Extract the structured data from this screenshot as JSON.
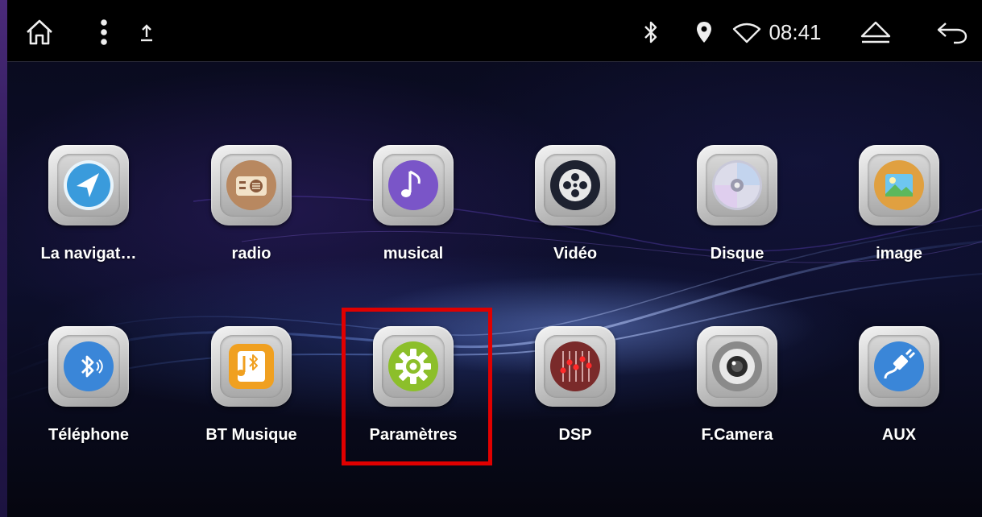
{
  "statusbar": {
    "home_icon": "home-icon",
    "menu_icon": "more-vertical-icon",
    "upload_icon": "upload-arrow-icon",
    "bluetooth_icon": "bluetooth-icon",
    "location_icon": "location-pin-icon",
    "wifi_icon": "wifi-icon",
    "time": "08:41",
    "eject_icon": "eject-icon",
    "back_icon": "back-arrow-icon"
  },
  "apps": [
    {
      "label": "La navigat…",
      "icon": "navigation-icon",
      "color": "#3a9bdc"
    },
    {
      "label": "radio",
      "icon": "radio-icon",
      "color": "#8a5a3c"
    },
    {
      "label": "musical",
      "icon": "music-note-icon",
      "color": "#7a55c8"
    },
    {
      "label": "Vidéo",
      "icon": "film-reel-icon",
      "color": "#2a2a2a"
    },
    {
      "label": "Disque",
      "icon": "disc-icon",
      "color": "#c8c8d8"
    },
    {
      "label": "image",
      "icon": "image-icon",
      "color": "#e0a040"
    },
    {
      "label": "Téléphone",
      "icon": "bluetooth-phone-icon",
      "color": "#3a86d8"
    },
    {
      "label": "BT Musique",
      "icon": "bt-music-icon",
      "color": "#f0a020"
    },
    {
      "label": "Paramètres",
      "icon": "gear-icon",
      "color": "#8cbf2a"
    },
    {
      "label": "DSP",
      "icon": "equalizer-icon",
      "color": "#7a2a2a"
    },
    {
      "label": "F.Camera",
      "icon": "camera-lens-icon",
      "color": "#6a6a6a"
    },
    {
      "label": "AUX",
      "icon": "aux-cable-icon",
      "color": "#3a86d8"
    }
  ],
  "highlight_color": "#e00000"
}
